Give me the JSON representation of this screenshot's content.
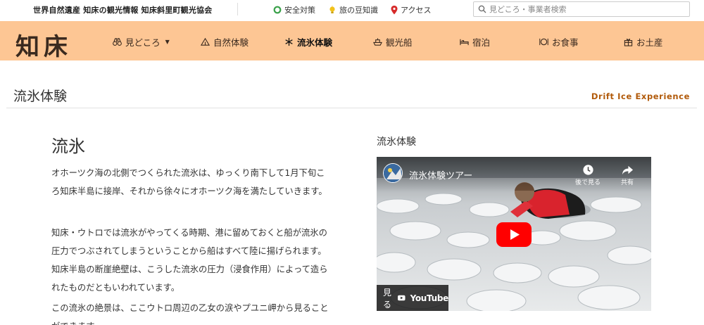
{
  "topbar": {
    "site_title": "世界自然遺産 知床の観光情報 知床斜里町観光協会",
    "links": [
      {
        "label": "安全対策",
        "icon": "safety-ring-icon"
      },
      {
        "label": "旅の豆知識",
        "icon": "lightbulb-icon"
      },
      {
        "label": "アクセス",
        "icon": "map-pin-icon"
      }
    ],
    "search_placeholder": "見どころ・事業者検索"
  },
  "nav": {
    "logo": "知床",
    "items": [
      {
        "label": "見どころ",
        "icon": "binoculars-icon",
        "has_dropdown": true
      },
      {
        "label": "自然体験",
        "icon": "tent-icon"
      },
      {
        "label": "流氷体験",
        "icon": "snowflake-icon",
        "active": true
      },
      {
        "label": "観光船",
        "icon": "ship-icon"
      },
      {
        "label": "宿泊",
        "icon": "bed-icon"
      },
      {
        "label": "お食事",
        "icon": "dish-icon"
      },
      {
        "label": "お土産",
        "icon": "gift-icon"
      }
    ]
  },
  "page": {
    "title": "流氷体験",
    "subtitle": "Drift Ice Experience"
  },
  "article": {
    "title": "流氷",
    "paragraphs": [
      "オホーツク海の北側でつくられた流氷は、ゆっくり南下して1月下旬ころ知床半島に接岸、それから徐々にオホーツク海を満たしていきます。",
      "知床・ウトロでは流氷がやってくる時期、港に留めておくと船が流氷の圧力でつぶされてしまうということから船はすべて陸に揚げられます。知床半島の断崖絶壁は、こうした流氷の圧力（浸食作用）によって造られたものだともいわれています。",
      "この流氷の絶景は、ここウトロ周辺の乙女の涙やプユニ岬から見ることができます。"
    ]
  },
  "video": {
    "section_label": "流氷体験",
    "title": "流氷体験ツアー",
    "action_later": "後で見る",
    "action_share": "共有",
    "watch_on": "見る",
    "brand": "YouTube",
    "colors": {
      "play": "#ff0000",
      "accent": "#b15a0a",
      "nav_bg": "#fdc694"
    }
  }
}
